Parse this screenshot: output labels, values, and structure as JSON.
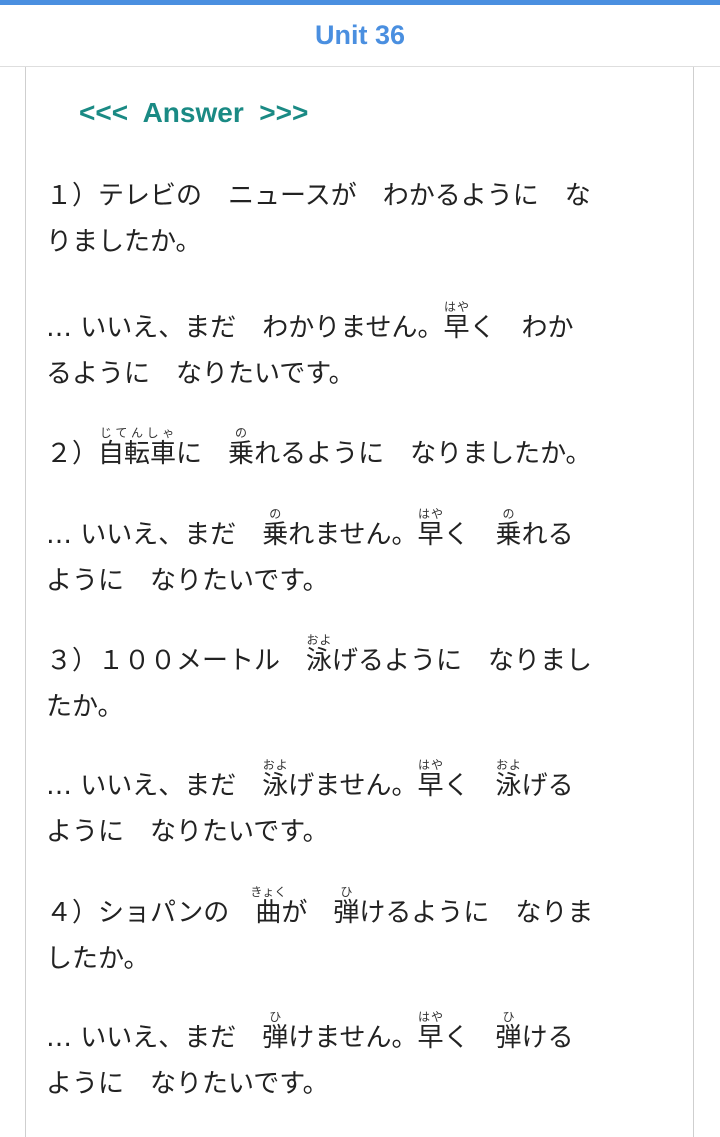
{
  "title": "Unit 36",
  "answer_heading": "<<<  Answer  >>>",
  "q1": {
    "l1": "１）テレビの　ニュースが　わかるように　な",
    "l2": "りましたか。"
  },
  "a1": {
    "p1": " …  いいえ、まだ　わかりません。",
    "k1": "早",
    "r1": "はや",
    "p2": "く　わか",
    "l2": "るように　なりたいです。"
  },
  "q2": {
    "p1": "２）",
    "k1": "自転車",
    "r1": "じてんしゃ",
    "p2": "に　",
    "k2": "乗",
    "r2": "の",
    "p3": "れるように　なりましたか。"
  },
  "a2": {
    "p1": " …  いいえ、まだ　",
    "k1": "乗",
    "r1": "の",
    "p2": "れません。",
    "k2": "早",
    "r2": "はや",
    "p3": "く　",
    "k3": "乗",
    "r3": "の",
    "p4": "れる",
    "l2": "ように　なりたいです。"
  },
  "q3": {
    "p1": "３）１００メートル　",
    "k1": "泳",
    "r1": "およ",
    "p2": "げるように　なりまし",
    "l2": "たか。"
  },
  "a3": {
    "p1": " …  いいえ、まだ　",
    "k1": "泳",
    "r1": "およ",
    "p2": "げません。",
    "k2": "早",
    "r2": "はや",
    "p3": "く　",
    "k3": "泳",
    "r3": "およ",
    "p4": "げる",
    "l2": "ように　なりたいです。"
  },
  "q4": {
    "p1": "４）ショパンの　",
    "k1": "曲",
    "r1": "きょく",
    "p2": "が　",
    "k2": "弾",
    "r2": "ひ",
    "p3": "けるように　なりま",
    "l2": "したか。"
  },
  "a4": {
    "p1": " …  いいえ、まだ　",
    "k1": "弾",
    "r1": "ひ",
    "p2": "けません。",
    "k2": "早",
    "r2": "はや",
    "p3": "く　",
    "k3": "弾",
    "r3": "ひ",
    "p4": "ける",
    "l2": "ように　なりたいです。"
  },
  "colors": {
    "title": "#4a8fe0",
    "heading": "#1a8a84",
    "text": "#222222"
  }
}
